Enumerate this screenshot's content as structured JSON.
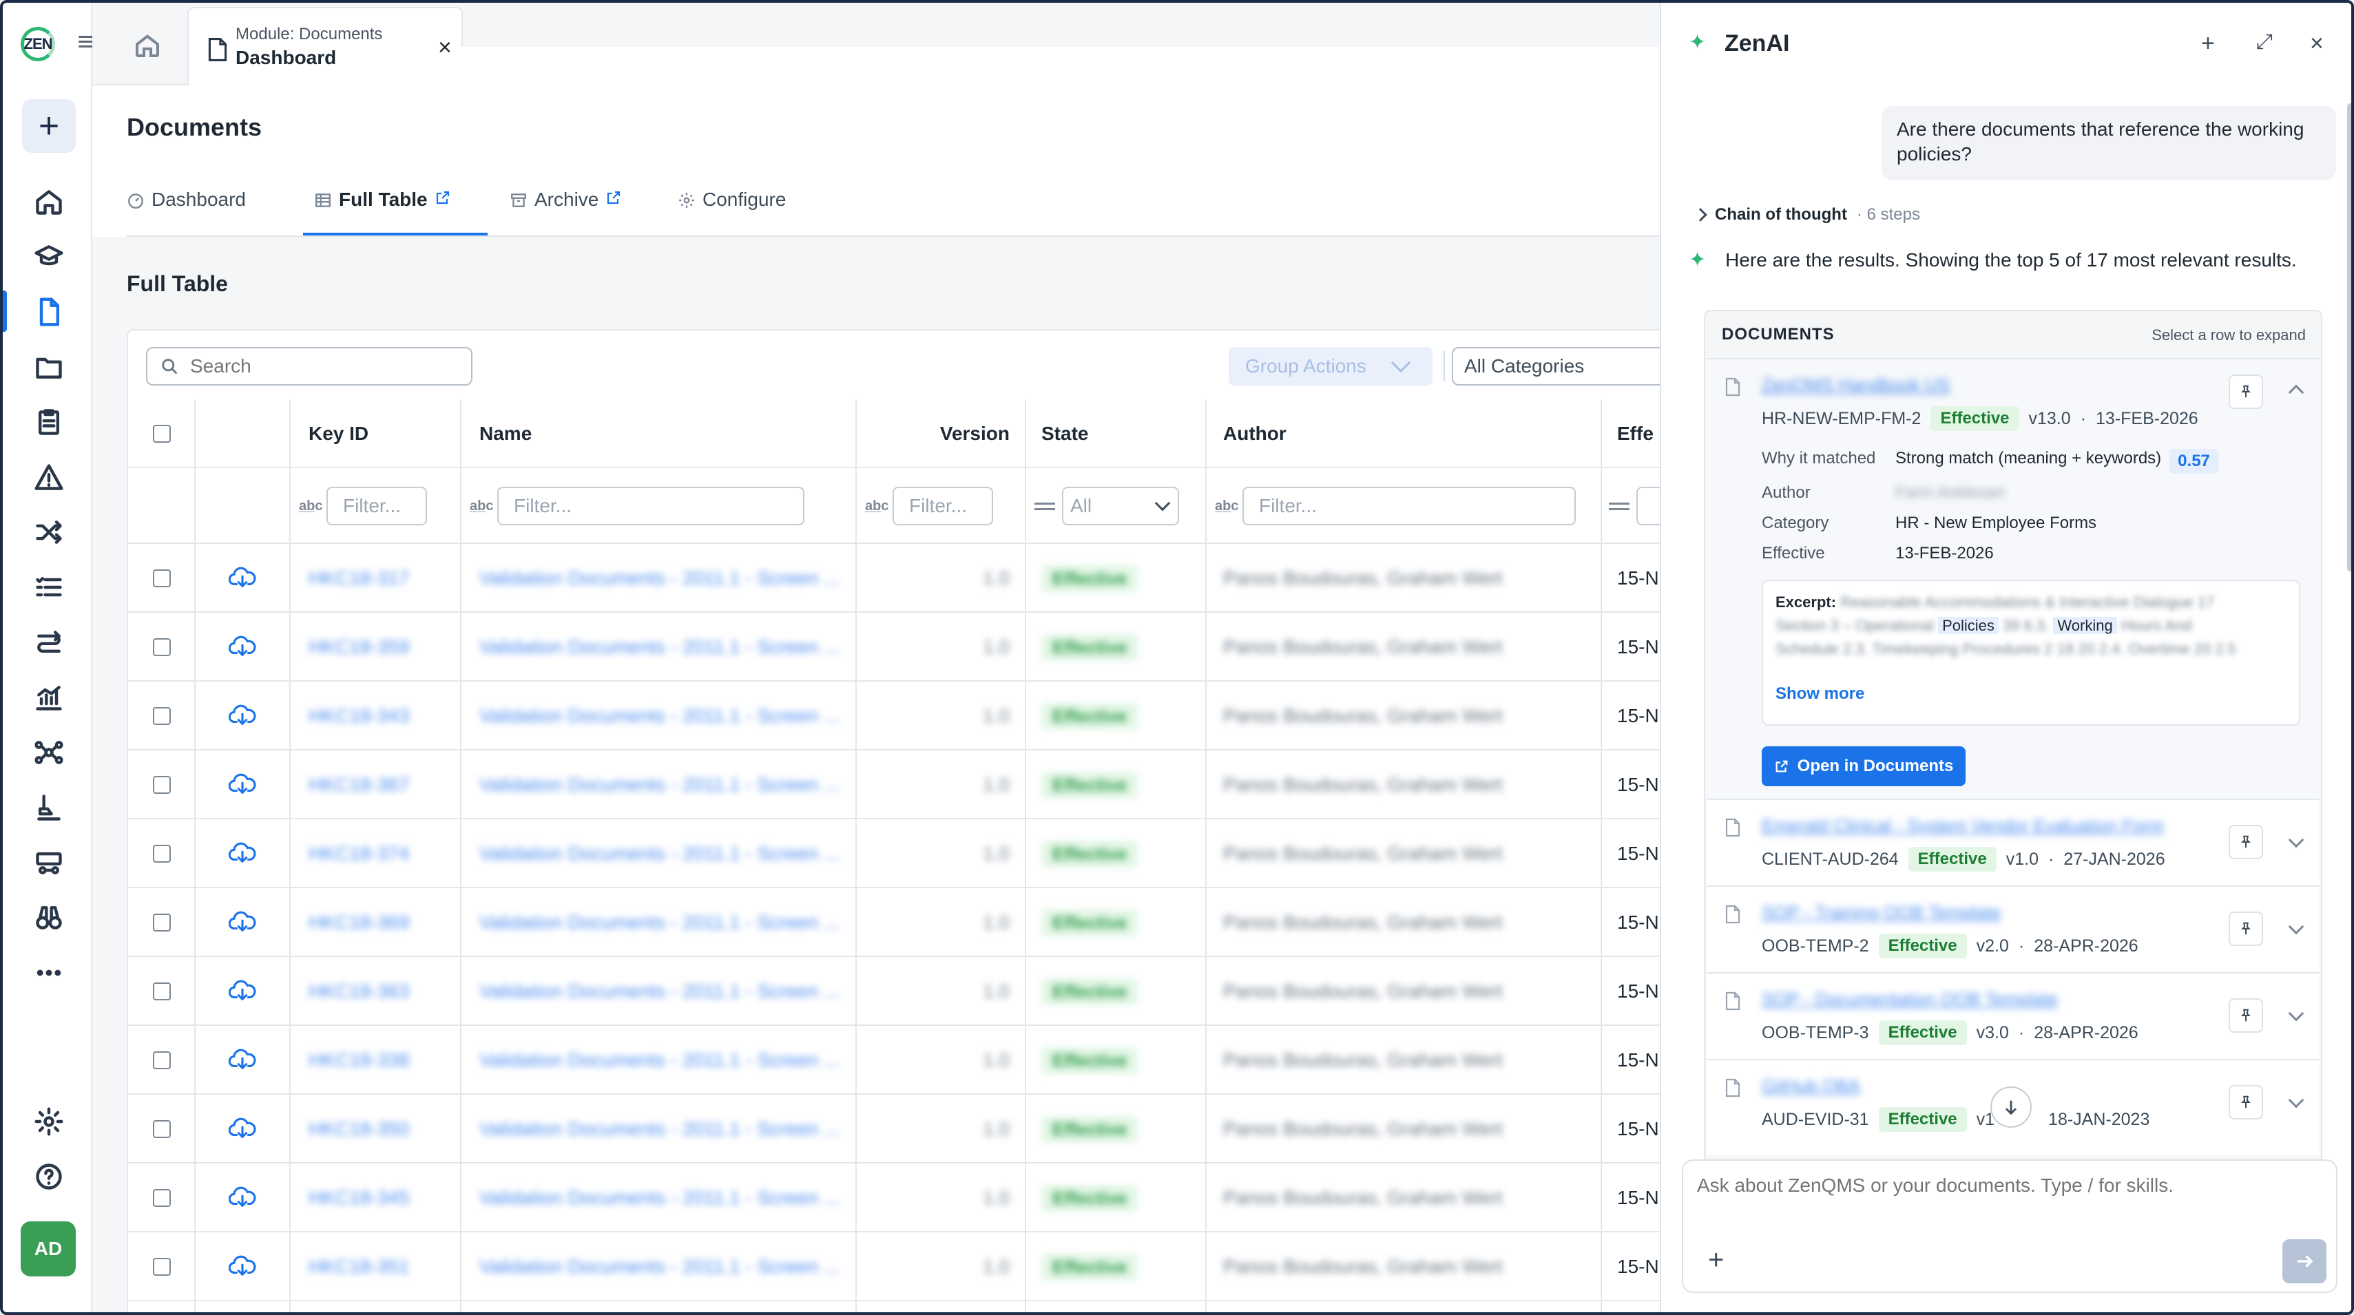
{
  "rail": {
    "logo": "ZEN",
    "avatar": "AD",
    "active_item": "documents",
    "icons": [
      "home-icon",
      "training-icon",
      "documents-icon",
      "folder-icon",
      "checklist-icon",
      "warning-icon",
      "shuffle-icon",
      "list-icon",
      "workflow-icon",
      "chart-icon",
      "network-icon",
      "audit-icon",
      "suppliers-icon",
      "binoculars-icon",
      "more-icon",
      "settings-icon",
      "help-icon"
    ]
  },
  "tabbar": {
    "tab_module": "Module: Documents",
    "tab_title": "Dashboard",
    "close": "×"
  },
  "page": {
    "title": "Documents",
    "subtabs": [
      "Dashboard",
      "Full Table",
      "Archive",
      "Configure"
    ],
    "active_subtab": "Full Table",
    "section_title": "Full Table"
  },
  "toolbar": {
    "search_placeholder": "Search",
    "group_actions": "Group Actions",
    "categories": "All Categories"
  },
  "table": {
    "columns": [
      "Key ID",
      "Name",
      "Version",
      "State",
      "Author",
      "Effe"
    ],
    "filters": {
      "key_id": "Filter...",
      "name": "Filter...",
      "version": "Filter...",
      "state": "All",
      "author": "Filter..."
    },
    "rows": [
      {
        "key": "HKC18-317",
        "name": "Validation Documents - 2011.1 - Screen ...",
        "version": "1.0",
        "state": "Effective",
        "author": "Panos Boudouras, Graham Wert",
        "effective": "15-N"
      },
      {
        "key": "HKC18-359",
        "name": "Validation Documents - 2011.1 - Screen ...",
        "version": "1.0",
        "state": "Effective",
        "author": "Panos Boudouras, Graham Wert",
        "effective": "15-N"
      },
      {
        "key": "HKC18-343",
        "name": "Validation Documents - 2011.1 - Screen ...",
        "version": "1.0",
        "state": "Effective",
        "author": "Panos Boudouras, Graham Wert",
        "effective": "15-N"
      },
      {
        "key": "HKC18-367",
        "name": "Validation Documents - 2011.1 - Screen ...",
        "version": "1.0",
        "state": "Effective",
        "author": "Panos Boudouras, Graham Wert",
        "effective": "15-N"
      },
      {
        "key": "HKC18-374",
        "name": "Validation Documents - 2011.1 - Screen ...",
        "version": "1.0",
        "state": "Effective",
        "author": "Panos Boudouras, Graham Wert",
        "effective": "15-N"
      },
      {
        "key": "HKC18-369",
        "name": "Validation Documents - 2011.1 - Screen ...",
        "version": "1.0",
        "state": "Effective",
        "author": "Panos Boudouras, Graham Wert",
        "effective": "15-N"
      },
      {
        "key": "HKC18-363",
        "name": "Validation Documents - 2011.1 - Screen ...",
        "version": "1.0",
        "state": "Effective",
        "author": "Panos Boudouras, Graham Wert",
        "effective": "15-N"
      },
      {
        "key": "HKC18-338",
        "name": "Validation Documents - 2011.1 - Screen ...",
        "version": "1.0",
        "state": "Effective",
        "author": "Panos Boudouras, Graham Wert",
        "effective": "15-N"
      },
      {
        "key": "HKC18-350",
        "name": "Validation Documents - 2011.1 - Screen ...",
        "version": "1.0",
        "state": "Effective",
        "author": "Panos Boudouras, Graham Wert",
        "effective": "15-N"
      },
      {
        "key": "HKC18-345",
        "name": "Validation Documents - 2011.1 - Screen ...",
        "version": "1.0",
        "state": "Effective",
        "author": "Panos Boudouras, Graham Wert",
        "effective": "15-N"
      },
      {
        "key": "HKC18-351",
        "name": "Validation Documents - 2011.1 - Screen ...",
        "version": "1.0",
        "state": "Effective",
        "author": "Panos Boudouras, Graham Wert",
        "effective": "15-N"
      }
    ]
  },
  "zenai": {
    "title": "ZenAI",
    "user_message": "Are there documents that reference the working policies?",
    "cot_label": "Chain of thought",
    "cot_steps": "· 6 steps",
    "answer": "Here are the results. Showing the top 5 of 17 most relevant results.",
    "docs_header": "DOCUMENTS",
    "docs_hint": "Select a row to expand",
    "docs": [
      {
        "title": "ZenQMS Handbook US",
        "id": "HR-NEW-EMP-FM-2",
        "state": "Effective",
        "version": "v13.0",
        "date": "13-FEB-2026"
      },
      {
        "title": "Emerald Clinical - System Vendor Evaluation Form",
        "id": "CLIENT-AUD-264",
        "state": "Effective",
        "version": "v1.0",
        "date": "27-JAN-2026"
      },
      {
        "title": "SOP - Training OOB Template",
        "id": "OOB-TEMP-2",
        "state": "Effective",
        "version": "v2.0",
        "date": "28-APR-2026"
      },
      {
        "title": "SOP - Documentation OOB Template",
        "id": "OOB-TEMP-3",
        "state": "Effective",
        "version": "v3.0",
        "date": "28-APR-2026"
      },
      {
        "title": "GitHub QBA",
        "id": "AUD-EVID-31",
        "state": "Effective",
        "version": "v1",
        "date": "18-JAN-2023"
      }
    ],
    "expanded": {
      "why_label": "Why it matched",
      "why_value": "Strong match (meaning + keywords)",
      "score": "0.57",
      "author_label": "Author",
      "author_value": "Farin Anklesari",
      "category_label": "Category",
      "category_value": "HR - New Employee Forms",
      "effective_label": "Effective",
      "effective_value": "13-FEB-2026",
      "excerpt_label": "Excerpt:",
      "excerpt_1": "Reasonable Accommodations & Interactive Dialogue 17",
      "excerpt_2a": "Section 3 – Operational",
      "excerpt_hl1": "Policies",
      "excerpt_2b": "39 6.3.",
      "excerpt_hl2": "Working",
      "excerpt_2c": "Hours And",
      "excerpt_3": "Schedule 2.3. Timekeeping Procedures 2 18 20 2.4. Overtime 20 2.5",
      "show_more": "Show more",
      "open_button": "Open in Documents"
    },
    "composer_placeholder": "Ask about ZenQMS or your documents. Type / for skills."
  }
}
